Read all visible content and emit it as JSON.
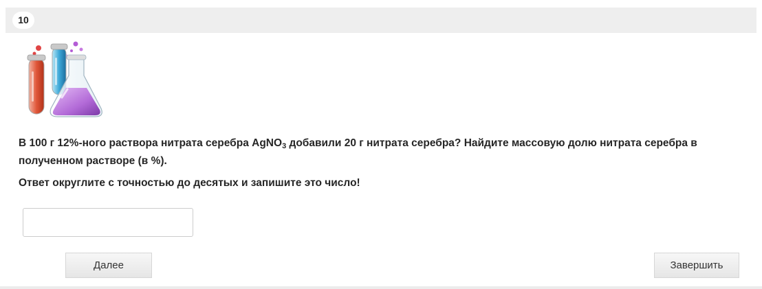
{
  "question": {
    "number": "10",
    "text_before_formula": "В 100 г 12%-ного раствора нитрата серебра AgNO",
    "formula_subscript": "3",
    "text_after_formula": " добавили 20 г нитрата серебра? Найдите массовую долю нитрата серебра в полученном растворе (в %).",
    "instruction": "Ответ округлите с точностью до десятых и запишите это число!",
    "illustration_icon": "chemistry-flasks-icon"
  },
  "answer": {
    "value": "",
    "placeholder": ""
  },
  "buttons": {
    "next_label": "Далее",
    "finish_label": "Завершить"
  },
  "colors": {
    "header_background": "#eeeeee",
    "button_gradient_top": "#f7f7f7",
    "button_gradient_bottom": "#e6e6e6"
  }
}
